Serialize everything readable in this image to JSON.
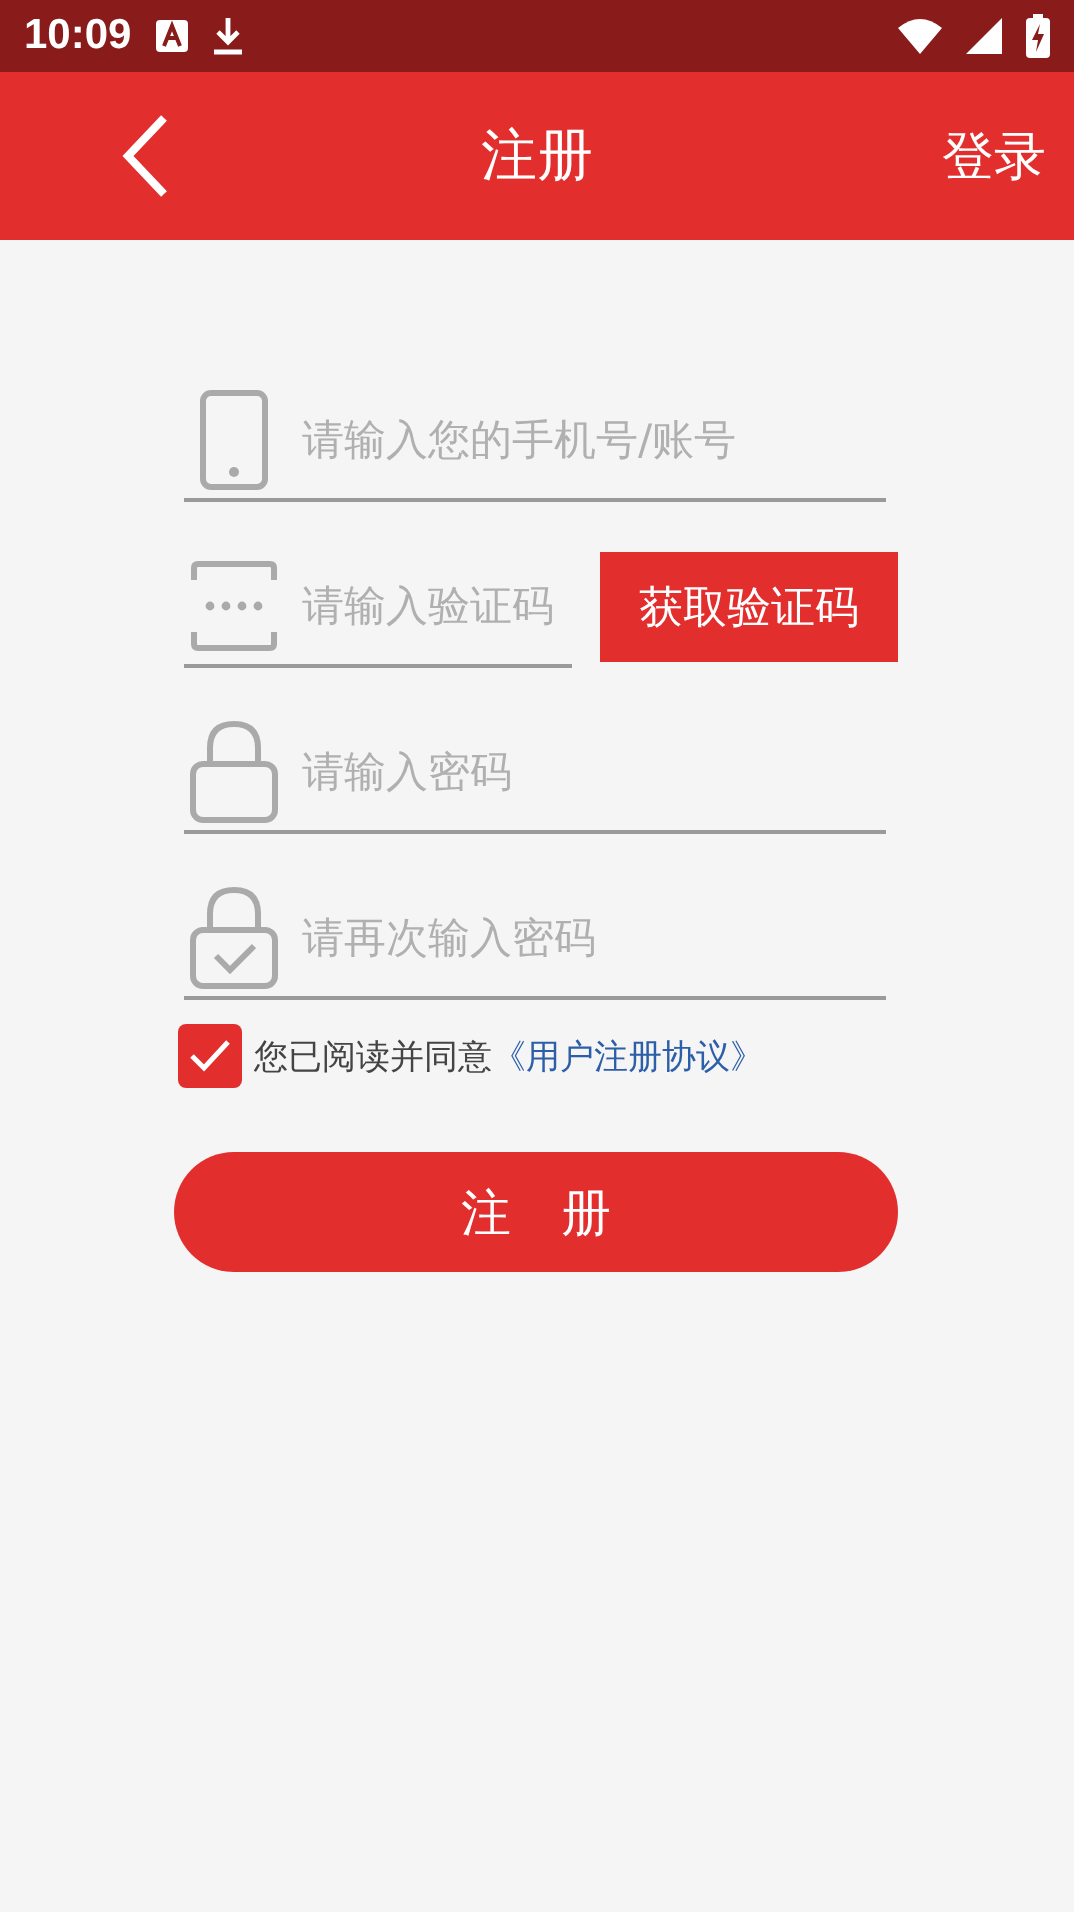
{
  "status_bar": {
    "time": "10:09"
  },
  "header": {
    "title": "注册",
    "action": "登录"
  },
  "fields": [
    {
      "kind": "phone",
      "placeholder": "请输入您的手机号/账号"
    },
    {
      "kind": "code",
      "placeholder": "请输入验证码"
    },
    {
      "kind": "lock",
      "placeholder": "请输入密码"
    },
    {
      "kind": "lock-check",
      "placeholder": "请再次输入密码"
    }
  ],
  "code_button": "获取验证码",
  "agreement": {
    "checked": true,
    "text": "您已阅读并同意",
    "link": "《用户注册协议》"
  },
  "submit": "注　册"
}
